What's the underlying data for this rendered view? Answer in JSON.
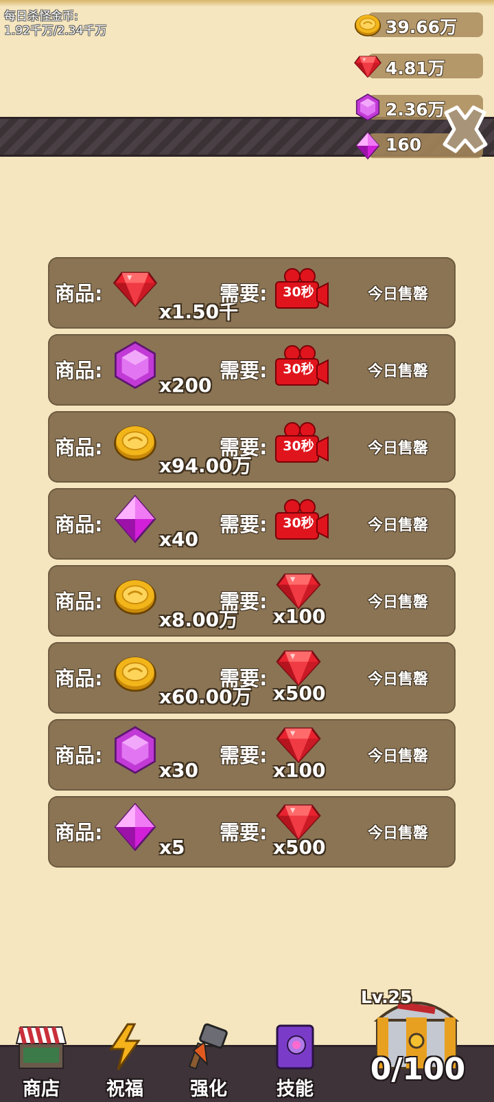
{
  "header": {
    "daily_kill_gold_label": "每日杀怪金币:",
    "daily_kill_gold_value": "1.92千万/2.34千万"
  },
  "resources": {
    "gold": "39.66万",
    "ruby": "4.81万",
    "amethyst": "2.36万",
    "diamond": "160"
  },
  "shop": {
    "items": [
      {
        "item_label": "商品:",
        "item_icon": "ruby-icon",
        "item_qty": "x1.50千",
        "need_label": "需要:",
        "cost_type": "video",
        "cost_text": "30秒",
        "status": "今日售罄"
      },
      {
        "item_label": "商品:",
        "item_icon": "amethyst-icon",
        "item_qty": "x200",
        "need_label": "需要:",
        "cost_type": "video",
        "cost_text": "30秒",
        "status": "今日售罄"
      },
      {
        "item_label": "商品:",
        "item_icon": "gold-coin-icon",
        "item_qty": "x94.00万",
        "need_label": "需要:",
        "cost_type": "video",
        "cost_text": "30秒",
        "status": "今日售罄"
      },
      {
        "item_label": "商品:",
        "item_icon": "diamond-icon",
        "item_qty": "x40",
        "need_label": "需要:",
        "cost_type": "video",
        "cost_text": "30秒",
        "status": "今日售罄"
      },
      {
        "item_label": "商品:",
        "item_icon": "gold-coin-icon",
        "item_qty": "x8.00万",
        "need_label": "需要:",
        "cost_type": "ruby",
        "cost_text": "x100",
        "status": "今日售罄"
      },
      {
        "item_label": "商品:",
        "item_icon": "gold-coin-icon",
        "item_qty": "x60.00万",
        "need_label": "需要:",
        "cost_type": "ruby",
        "cost_text": "x500",
        "status": "今日售罄"
      },
      {
        "item_label": "商品:",
        "item_icon": "amethyst-icon",
        "item_qty": "x30",
        "need_label": "需要:",
        "cost_type": "ruby",
        "cost_text": "x100",
        "status": "今日售罄"
      },
      {
        "item_label": "商品:",
        "item_icon": "diamond-icon",
        "item_qty": "x5",
        "need_label": "需要:",
        "cost_type": "ruby",
        "cost_text": "x500",
        "status": "今日售罄"
      }
    ]
  },
  "nav": {
    "shop": "商店",
    "blessing": "祝福",
    "upgrade": "强化",
    "skills": "技能"
  },
  "chest": {
    "level": "Lv.25",
    "count": "0/100"
  },
  "colors": {
    "background": "#f5e6bf",
    "row": "#8a7454",
    "ruby": "#e8232f",
    "amethyst": "#c13ad6",
    "gold": "#f2b51a",
    "video": "#e0141c"
  }
}
